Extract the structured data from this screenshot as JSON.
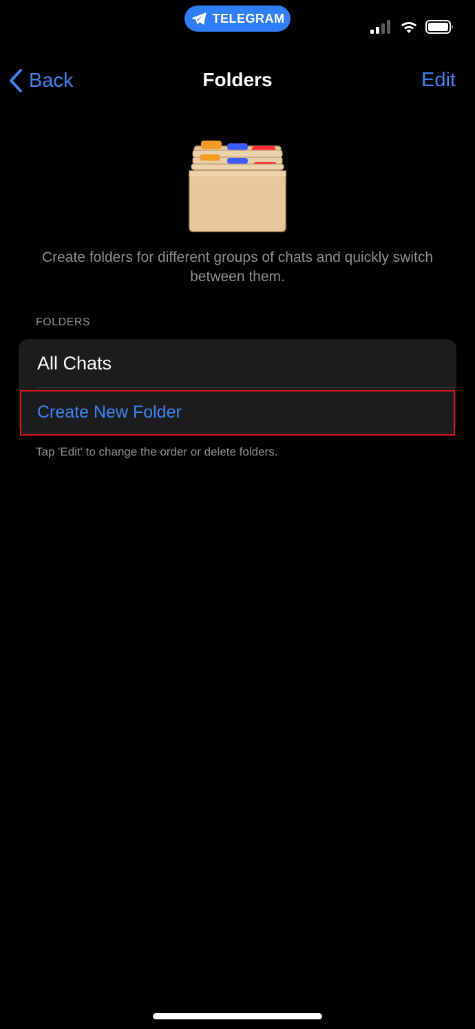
{
  "status_bar": {
    "app_pill_label": "TELEGRAM",
    "pill_color": "#2f7ef6"
  },
  "nav": {
    "back_label": "Back",
    "title": "Folders",
    "edit_label": "Edit",
    "accent_color": "#3e85f1"
  },
  "illustration": {
    "icon": "folders-card-file-icon"
  },
  "description": "Create folders for different groups of chats and quickly switch between them.",
  "folders_section": {
    "header": "FOLDERS",
    "items": [
      {
        "label": "All Chats"
      },
      {
        "label": "Create New Folder"
      }
    ],
    "footer": "Tap 'Edit' to change the order or delete folders."
  },
  "highlight_color": "#e0141c"
}
